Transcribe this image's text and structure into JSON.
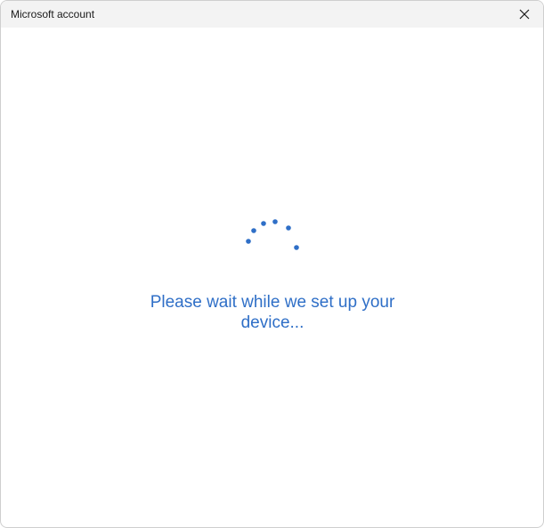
{
  "window": {
    "title": "Microsoft account",
    "close_icon": "close-icon"
  },
  "main": {
    "spinner_icon": "loading-spinner-icon",
    "message": "Please wait while we set up your device..."
  },
  "colors": {
    "accent": "#2f6fc7",
    "titlebar_bg": "#f3f3f3",
    "background": "#ffffff"
  }
}
